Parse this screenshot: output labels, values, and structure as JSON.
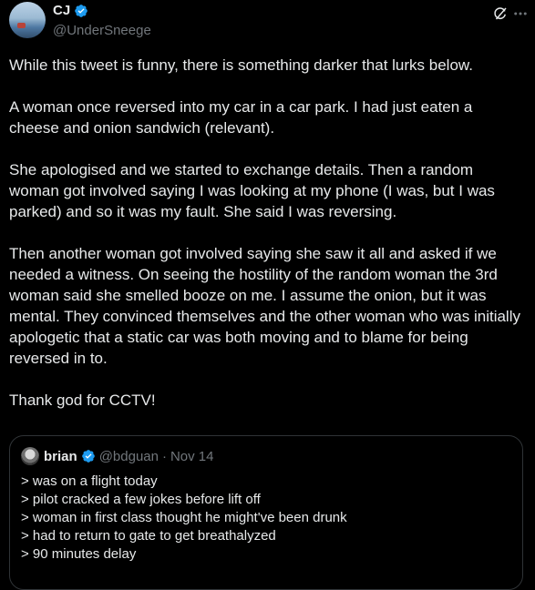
{
  "author": {
    "display_name": "CJ",
    "handle": "@UnderSneege"
  },
  "tweet": {
    "paragraphs": [
      "While this tweet is funny, there is something darker that lurks below.",
      "A woman once reversed into my car in a car park. I had just eaten a cheese and onion sandwich (relevant).",
      "She apologised and we started to exchange details. Then a random woman got involved saying I was looking at my phone (I was, but I was parked) and so it was my fault.  She said I was reversing.",
      "Then another woman got involved saying she saw it all and asked if we needed a witness. On seeing the hostility of the random woman the 3rd woman said she smelled booze on me. I assume the onion, but it was mental. They convinced themselves and the other woman who was initially apologetic that a static car was both moving and to blame for being reversed in to.",
      "Thank god for CCTV!"
    ]
  },
  "quote": {
    "display_name": "brian",
    "handle": "@bdguan",
    "separator": "·",
    "date": "Nov 14",
    "lines": [
      "> was on a flight today",
      "> pilot cracked a few jokes before lift off",
      "> woman in first class thought he might've been drunk",
      "> had to return to gate to get breathalyzed",
      "> 90 minutes delay"
    ]
  },
  "icons": {
    "verified": "verified-badge-icon",
    "grok": "grok-icon",
    "more": "more-icon"
  },
  "colors": {
    "background": "#000000",
    "text": "#e7e9ea",
    "secondary_text": "#71767b",
    "verified_blue": "#1d9bf0",
    "border": "#2f3336"
  }
}
